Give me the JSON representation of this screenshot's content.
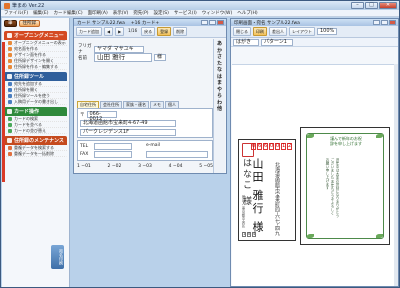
{
  "app": {
    "title": "筆まめ Ver.22",
    "menu": [
      "ファイル(F)",
      "編集(E)",
      "カード編集(C)",
      "面印刷(A)",
      "表示(V)",
      "宛先(P)",
      "設定(S)",
      "サービス(I)",
      "ウィンドウ(W)",
      "ヘルプ(H)"
    ]
  },
  "sidebar": {
    "top_buttons": [
      "筆",
      "住所録"
    ],
    "sections": [
      {
        "title": "オープニングメニュー",
        "color": "#d44a22",
        "items": [
          "オープニングメニューの表示",
          "宛名面を作る",
          "デザイン面を作る",
          "住所録デザインを開く",
          "住所録を作る・編集する"
        ]
      },
      {
        "title": "住所録ツール",
        "color": "#2f5f9c",
        "items": [
          "宛先を追加する",
          "住所録を開く",
          "住所録ツールを使う",
          "入稿用データの書き出し"
        ]
      },
      {
        "title": "カード操作",
        "color": "#2f8a3c",
        "items": [
          "カードの検索",
          "カードを並べる",
          "カードの並び替え"
        ]
      },
      {
        "title": "住所録のメンテナンス",
        "color": "#c54a1e",
        "items": [
          "重複データを検索する",
          "重複データを一括削除"
        ]
      }
    ],
    "vertical_tab": "宛名印刷"
  },
  "card_window": {
    "title": "カード サンプル22.fwa",
    "subtitle": "+16 カード+",
    "toolbar": [
      "カード追加",
      "◀",
      "▶",
      "1/16",
      "戻る",
      "登録",
      "削除"
    ],
    "name_label": "名前",
    "name_value": "山田 雅行",
    "furigana_value": "ヤマダ マサユキ",
    "honorific": "様",
    "tabs": [
      "自宅住所",
      "会社住所",
      "家族・連名",
      "メモ",
      "個人"
    ],
    "zip_value": "066-0012",
    "address_value": "北海道函館市宝来町4-67-49",
    "building_value": "パークレジデンス1F",
    "phone_label": "TEL",
    "fax_label": "FAX",
    "mobile_label": "携帯電話",
    "email_label": "e-mail",
    "bottom_items": [
      "1 −01",
      "2 −02",
      "3 −03",
      "4 −04",
      "5 −05"
    ],
    "kana": [
      "あ",
      "か",
      "さ",
      "た",
      "な",
      "は",
      "ま",
      "や",
      "ら",
      "わ",
      "他"
    ]
  },
  "print_window": {
    "title": "印刷画面・宛名 サンプル22.fwa",
    "toolbar": [
      "閉じる",
      "印刷",
      "差出人",
      "レイアウト",
      "100%"
    ],
    "layout_label": "パターン1",
    "template_label": "はがき"
  },
  "postcard": {
    "zip": [
      "0",
      "6",
      "6",
      "0",
      "0",
      "1",
      "2"
    ],
    "recipient": "山田 雅行 様",
    "recipient_line2": "はなこ 様",
    "address": "北海道函館市宝来町四‐六七‐四九",
    "sender": "差出人 東京都中央区",
    "sender_zip": [
      "1",
      "0",
      "4"
    ]
  },
  "greeting": {
    "title": "謹んで新年のお祝辞を申し上げます",
    "body": "旧年中は大変お世話になりありがとうございました 本年もどうぞよろしくお願い申し上げます"
  }
}
